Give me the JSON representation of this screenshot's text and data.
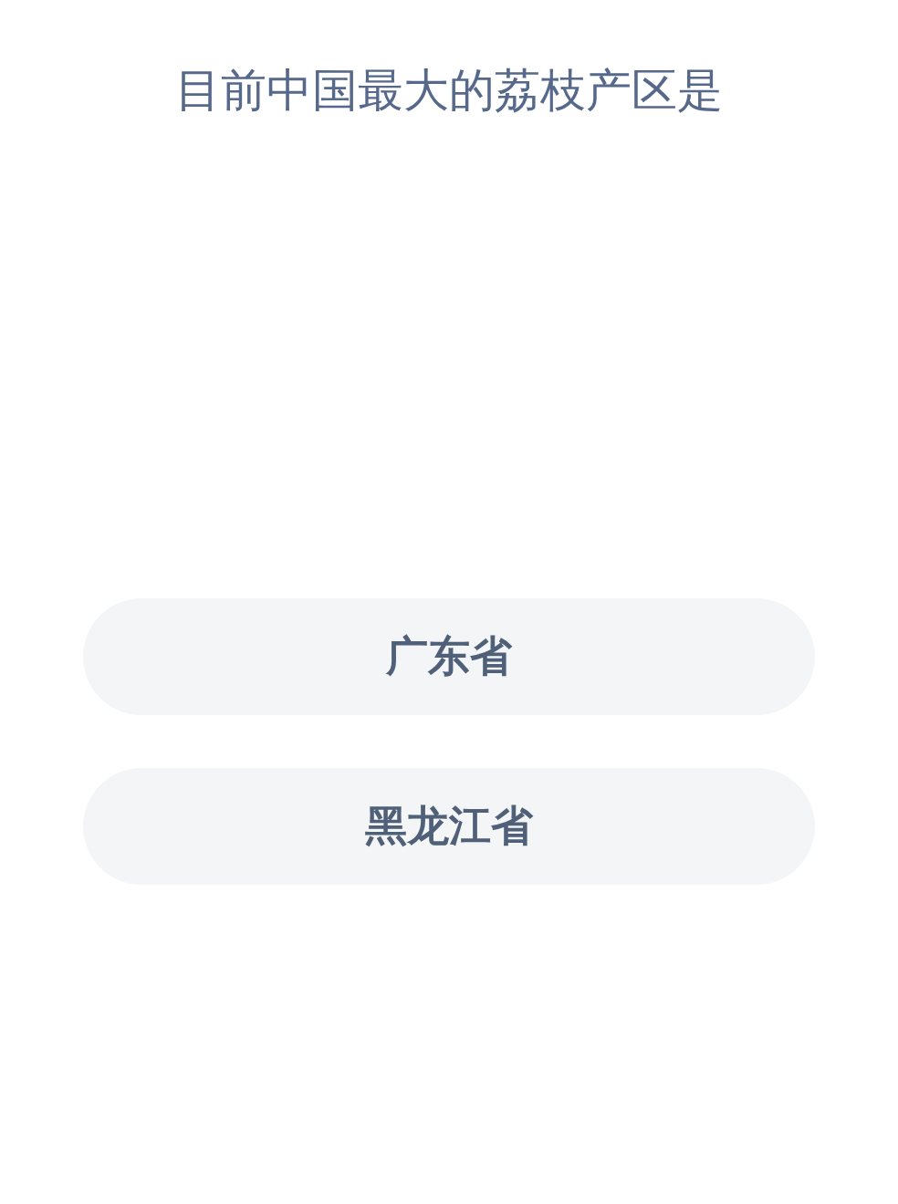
{
  "question": "目前中国最大的荔枝产区是",
  "options": [
    {
      "label": "广东省"
    },
    {
      "label": "黑龙江省"
    }
  ]
}
